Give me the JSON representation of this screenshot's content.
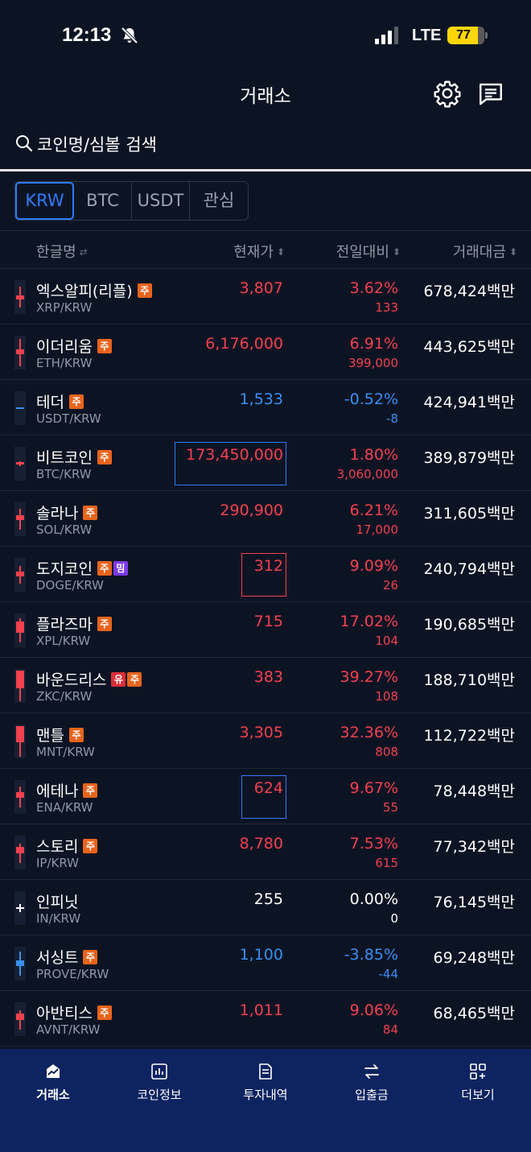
{
  "status": {
    "time": "12:13",
    "network": "LTE",
    "battery": "77"
  },
  "header": {
    "title": "거래소",
    "settings_icon": "gear-icon",
    "chat_icon": "chat-icon"
  },
  "search": {
    "placeholder": "코인명/심볼 검색"
  },
  "tabs": [
    {
      "label": "KRW",
      "active": true
    },
    {
      "label": "BTC",
      "active": false
    },
    {
      "label": "USDT",
      "active": false
    },
    {
      "label": "관심",
      "active": false
    }
  ],
  "columns": {
    "name": "한글명",
    "price": "현재가",
    "change": "전일대비",
    "volume": "거래대금"
  },
  "colors": {
    "up": "#f2414f",
    "down": "#3a8ff2",
    "accent": "#2f7bf5",
    "caution_badge": "#e8641c",
    "meme_badge": "#7c3aed",
    "warn_badge": "#d92f3a",
    "nav_bg": "#0e2461"
  },
  "coins": [
    {
      "name": "엑스알피(리플)",
      "symbol": "XRP/KRW",
      "badges": [
        "주"
      ],
      "price": "3,807",
      "pct": "3.62%",
      "diff": "133",
      "volume": "678,424백만",
      "dir": "up"
    },
    {
      "name": "이더리움",
      "symbol": "ETH/KRW",
      "badges": [
        "주"
      ],
      "price": "6,176,000",
      "pct": "6.91%",
      "diff": "399,000",
      "volume": "443,625백만",
      "dir": "up"
    },
    {
      "name": "테더",
      "symbol": "USDT/KRW",
      "badges": [
        "주"
      ],
      "price": "1,533",
      "pct": "-0.52%",
      "diff": "-8",
      "volume": "424,941백만",
      "dir": "down"
    },
    {
      "name": "비트코인",
      "symbol": "BTC/KRW",
      "badges": [
        "주"
      ],
      "price": "173,450,000",
      "pct": "1.80%",
      "diff": "3,060,000",
      "volume": "389,879백만",
      "dir": "up",
      "highlight": "down"
    },
    {
      "name": "솔라나",
      "symbol": "SOL/KRW",
      "badges": [
        "주"
      ],
      "price": "290,900",
      "pct": "6.21%",
      "diff": "17,000",
      "volume": "311,605백만",
      "dir": "up"
    },
    {
      "name": "도지코인",
      "symbol": "DOGE/KRW",
      "badges": [
        "주",
        "밈"
      ],
      "price": "312",
      "pct": "9.09%",
      "diff": "26",
      "volume": "240,794백만",
      "dir": "up",
      "highlight": "up"
    },
    {
      "name": "플라즈마",
      "symbol": "XPL/KRW",
      "badges": [
        "주"
      ],
      "price": "715",
      "pct": "17.02%",
      "diff": "104",
      "volume": "190,685백만",
      "dir": "up"
    },
    {
      "name": "바운드리스",
      "symbol": "ZKC/KRW",
      "badges": [
        "유",
        "주"
      ],
      "price": "383",
      "pct": "39.27%",
      "diff": "108",
      "volume": "188,710백만",
      "dir": "up"
    },
    {
      "name": "맨틀",
      "symbol": "MNT/KRW",
      "badges": [
        "주"
      ],
      "price": "3,305",
      "pct": "32.36%",
      "diff": "808",
      "volume": "112,722백만",
      "dir": "up"
    },
    {
      "name": "에테나",
      "symbol": "ENA/KRW",
      "badges": [
        "주"
      ],
      "price": "624",
      "pct": "9.67%",
      "diff": "55",
      "volume": "78,448백만",
      "dir": "up",
      "highlight": "down"
    },
    {
      "name": "스토리",
      "symbol": "IP/KRW",
      "badges": [
        "주"
      ],
      "price": "8,780",
      "pct": "7.53%",
      "diff": "615",
      "volume": "77,342백만",
      "dir": "up"
    },
    {
      "name": "인피닛",
      "symbol": "IN/KRW",
      "badges": [],
      "price": "255",
      "pct": "0.00%",
      "diff": "0",
      "volume": "76,145백만",
      "dir": "flat"
    },
    {
      "name": "서싱트",
      "symbol": "PROVE/KRW",
      "badges": [
        "주"
      ],
      "price": "1,100",
      "pct": "-3.85%",
      "diff": "-44",
      "volume": "69,248백만",
      "dir": "down"
    },
    {
      "name": "아반티스",
      "symbol": "AVNT/KRW",
      "badges": [
        "주"
      ],
      "price": "1,011",
      "pct": "9.06%",
      "diff": "84",
      "volume": "68,465백만",
      "dir": "up"
    }
  ],
  "bottom_nav": [
    {
      "label": "거래소",
      "icon": "exchange-chart-icon",
      "active": true
    },
    {
      "label": "코인정보",
      "icon": "bar-chart-icon",
      "active": false
    },
    {
      "label": "투자내역",
      "icon": "document-icon",
      "active": false
    },
    {
      "label": "입출금",
      "icon": "transfer-arrows-icon",
      "active": false
    },
    {
      "label": "더보기",
      "icon": "more-grid-icon",
      "active": false
    }
  ]
}
